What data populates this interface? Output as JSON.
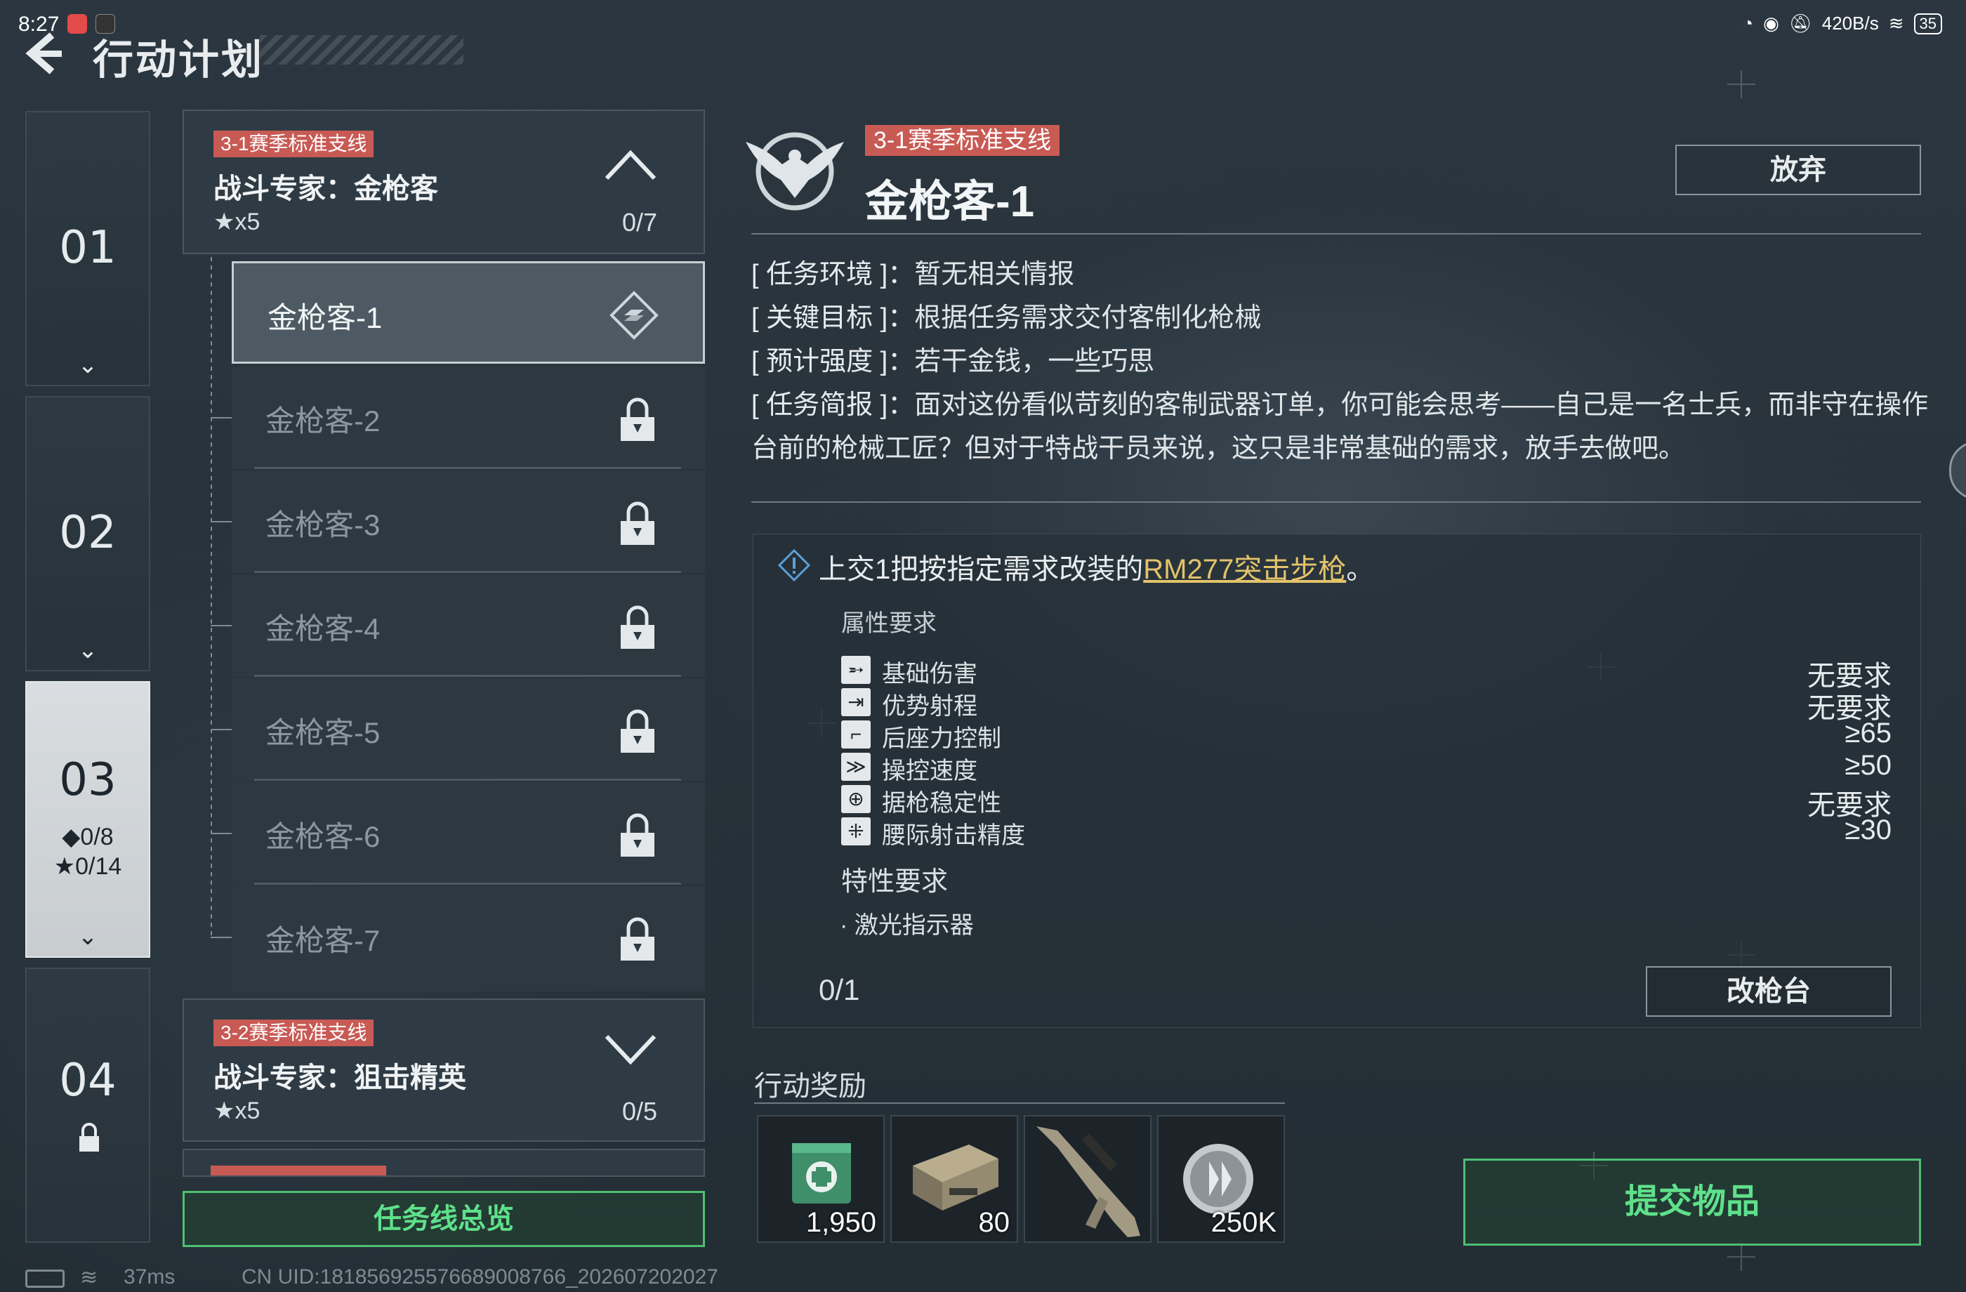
{
  "status_bar": {
    "time": "8:27",
    "net_speed": "420B/s",
    "battery": "35"
  },
  "header": {
    "title": "行动计划"
  },
  "chapters": [
    {
      "num": "01"
    },
    {
      "num": "02"
    },
    {
      "num": "03",
      "diamond_progress": "◆0/8",
      "star_progress": "★0/14"
    },
    {
      "num": "04"
    }
  ],
  "questlines": [
    {
      "tag": "3-1赛季标准支线",
      "name": "战斗专家：金枪客",
      "stars": "★x5",
      "progress": "0/7"
    },
    {
      "tag": "3-2赛季标准支线",
      "name": "战斗专家：狙击精英",
      "stars": "★x5",
      "progress": "0/5"
    }
  ],
  "missions": [
    "金枪客-1",
    "金枪客-2",
    "金枪客-3",
    "金枪客-4",
    "金枪客-5",
    "金枪客-6",
    "金枪客-7"
  ],
  "overview_button": "任务线总览",
  "detail": {
    "tag": "3-1赛季标准支线",
    "title": "金枪客-1",
    "abandon_button": "放弃",
    "environment_key": "[ 任务环境 ]：",
    "environment": "暂无相关情报",
    "objective_key": "[ 关键目标 ]：",
    "objective": "根据任务需求交付客制化枪械",
    "intensity_key": "[ 预计强度 ]：",
    "intensity": "若干金钱，一些巧思",
    "briefing_key": "[ 任务简报 ]：",
    "briefing": "面对这份看似苛刻的客制武器订单，你可能会思考——自己是一名士兵，而非守在操作台前的枪械工匠？但对于特战干员来说，这只是非常基础的需求，放手去做吧。"
  },
  "requirement": {
    "text_prefix": "上交1把按指定需求改装的",
    "weapon_link": "RM277突击步枪",
    "text_suffix": "。",
    "attributes_label": "属性要求",
    "attributes": [
      {
        "name": "基础伤害",
        "value": "无要求",
        "icon": "damage-icon"
      },
      {
        "name": "优势射程",
        "value": "无要求",
        "icon": "range-icon"
      },
      {
        "name": "后座力控制",
        "value": "≥65",
        "icon": "recoil-icon"
      },
      {
        "name": "操控速度",
        "value": "≥50",
        "icon": "handling-icon"
      },
      {
        "name": "据枪稳定性",
        "value": "无要求",
        "icon": "stability-icon"
      },
      {
        "name": "腰际射击精度",
        "value": "≥30",
        "icon": "hipfire-icon"
      }
    ],
    "traits_label": "特性要求",
    "trait": "· 激光指示器",
    "count": "0/1",
    "bench_button": "改枪台"
  },
  "rewards": {
    "label": "行动奖励",
    "items": [
      {
        "amount": "1,950",
        "icon": "medic-crate-icon"
      },
      {
        "amount": "80",
        "icon": "ammo-box-icon"
      },
      {
        "amount": "",
        "icon": "rifle-icon"
      },
      {
        "amount": "250K",
        "icon": "coin-icon"
      }
    ]
  },
  "submit_button": "提交物品",
  "bottom": {
    "ping": "37ms",
    "uid": "CN UID:18185692557668900876​6_202607202027"
  }
}
